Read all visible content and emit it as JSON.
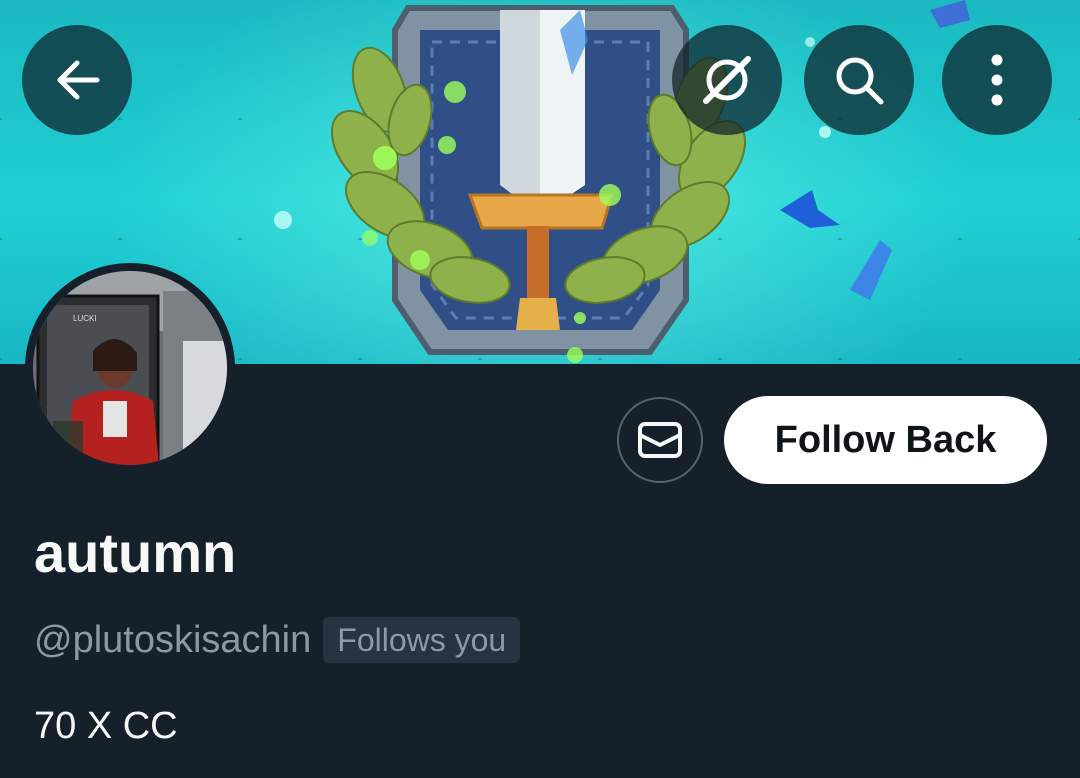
{
  "header": {
    "back_icon": "arrow-left-icon",
    "grok_icon": "grok-icon",
    "search_icon": "search-icon",
    "more_icon": "more-vertical-icon"
  },
  "profile": {
    "display_name": "autumn",
    "handle": "@plutoskisachin",
    "follows_you_label": "Follows you",
    "bio": "70 X CC"
  },
  "actions": {
    "message_icon": "envelope-icon",
    "follow_label": "Follow Back"
  },
  "colors": {
    "background": "#15202b",
    "text_primary": "#f7f9f9",
    "text_secondary": "#8b98a5",
    "follow_button_bg": "#ffffff",
    "badge_bg": "#273340"
  }
}
